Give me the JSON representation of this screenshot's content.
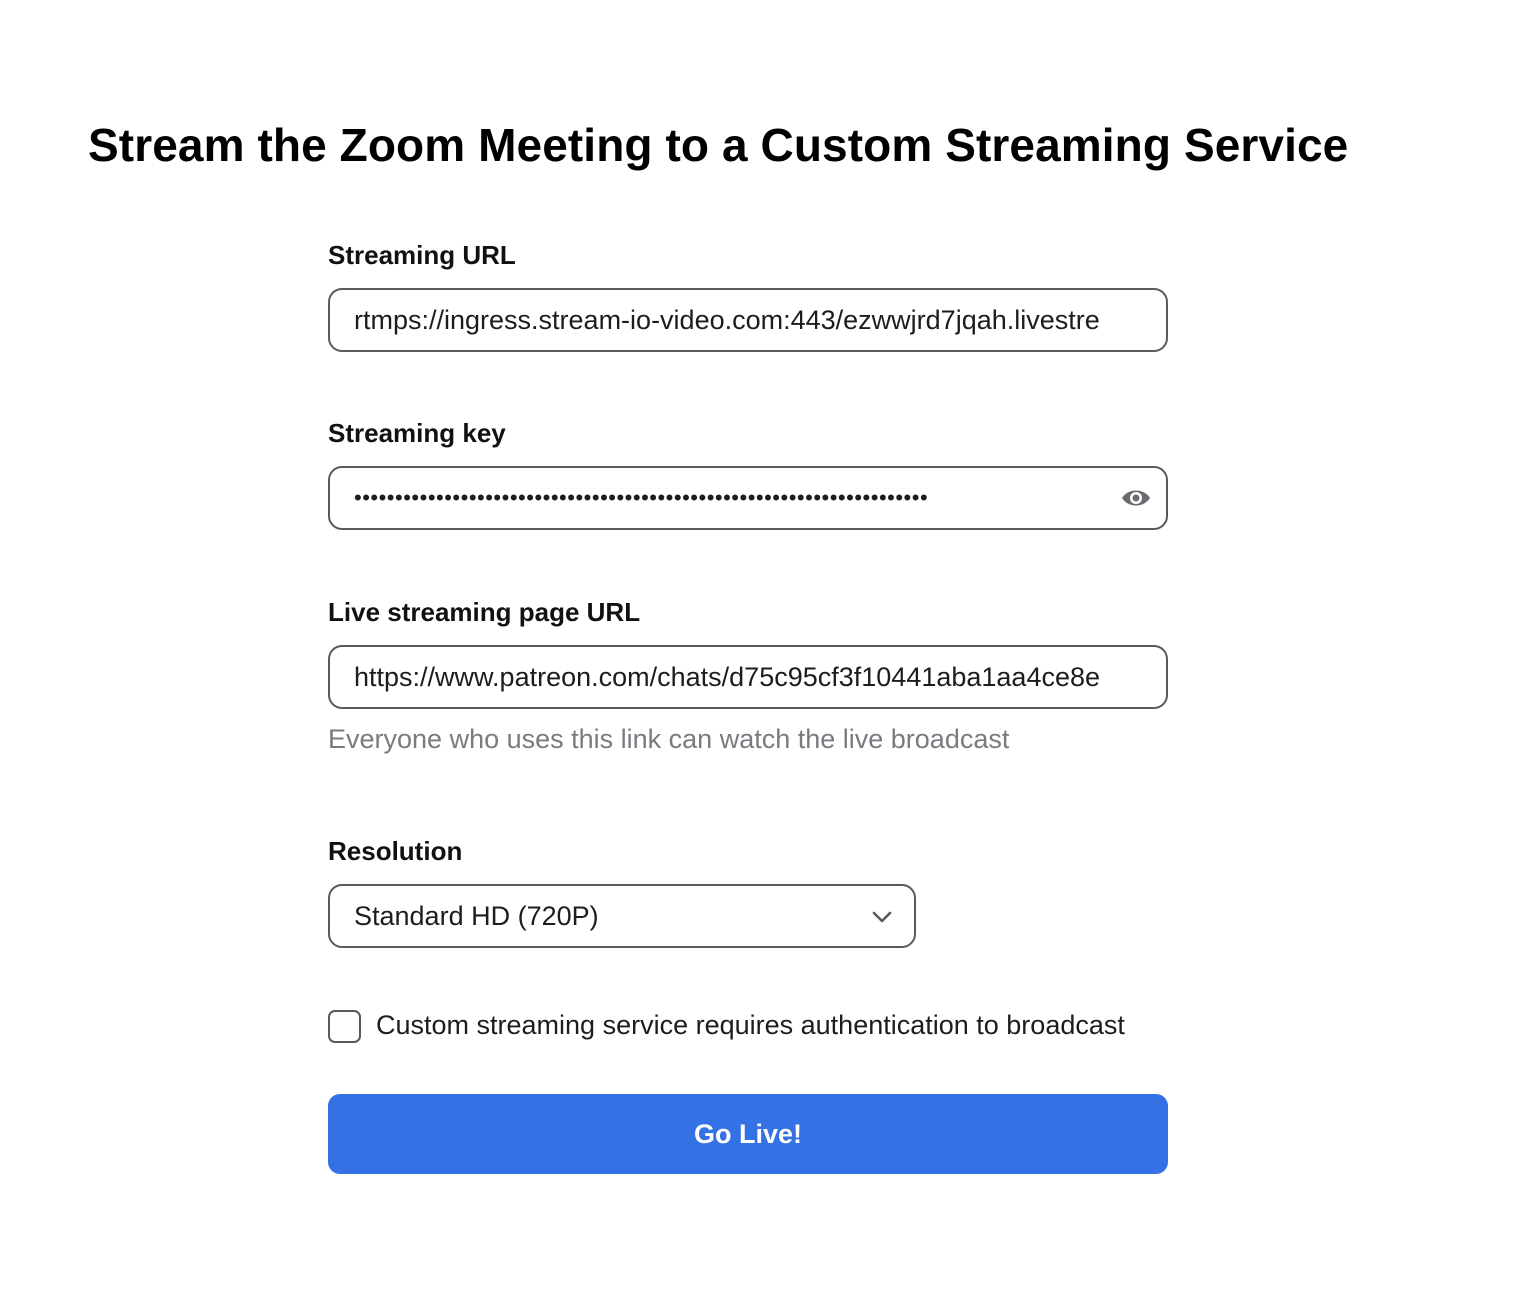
{
  "page": {
    "title": "Stream the Zoom Meeting to a Custom Streaming Service"
  },
  "streaming_url": {
    "label": "Streaming URL",
    "value": "rtmps://ingress.stream-io-video.com:443/ezwwjrd7jqah.livestre"
  },
  "streaming_key": {
    "label": "Streaming key",
    "value": "••••••••••••••••••••••••••••••••••••••••••••••••••••••••••••••••••••••",
    "icon": "eye-icon"
  },
  "live_page_url": {
    "label": "Live streaming page URL",
    "value": "https://www.patreon.com/chats/d75c95cf3f10441aba1aa4ce8e",
    "helper": "Everyone who uses this link can watch the live broadcast"
  },
  "resolution": {
    "label": "Resolution",
    "selected": "Standard HD (720P)",
    "icon": "chevron-down-icon"
  },
  "auth_checkbox": {
    "label": "Custom streaming service requires authentication to broadcast",
    "checked": false
  },
  "go_live_button": {
    "label": "Go Live!"
  },
  "colors": {
    "primary_button": "#3371e4",
    "field_border": "#5a5a5e",
    "helper_text": "#7a7a80",
    "text": "#111111",
    "background": "#ffffff"
  }
}
